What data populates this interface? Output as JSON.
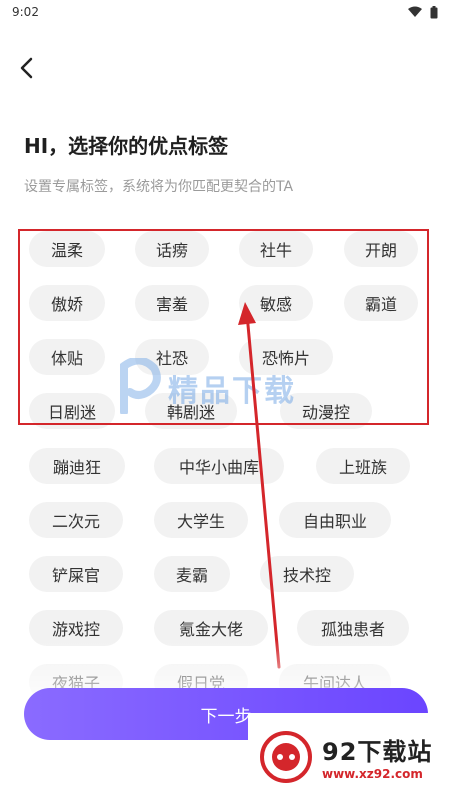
{
  "status_bar": {
    "time": "9:02",
    "wifi_icon": "wifi-icon",
    "battery_icon": "battery-icon"
  },
  "header": {
    "back_icon": "chevron-left-icon"
  },
  "title": "HI，选择你的优点标签",
  "subtitle": "设置专属标签，系统将为你匹配更契合的TA",
  "tags": [
    "温柔",
    "话痨",
    "社牛",
    "开朗",
    "傲娇",
    "害羞",
    "敏感",
    "霸道",
    "体贴",
    "社恐",
    "恐怖片",
    "日剧迷",
    "韩剧迷",
    "动漫控",
    "蹦迪狂",
    "中华小曲库",
    "上班族",
    "二次元",
    "大学生",
    "自由职业",
    "铲屎官",
    "麦霸",
    "技术控",
    "游戏控",
    "氪金大佬",
    "孤独患者",
    "夜猫子",
    "假日党",
    "午间达人"
  ],
  "next_button": "下一步",
  "watermark_mid": "精品下载",
  "watermark_logo": {
    "main": "92下载站",
    "url": "www.xz92.com"
  },
  "colors": {
    "accent_start": "#8a6bff",
    "accent_end": "#6b45ff",
    "annotation": "#d4262b",
    "tag_bg": "#f2f2f2"
  }
}
